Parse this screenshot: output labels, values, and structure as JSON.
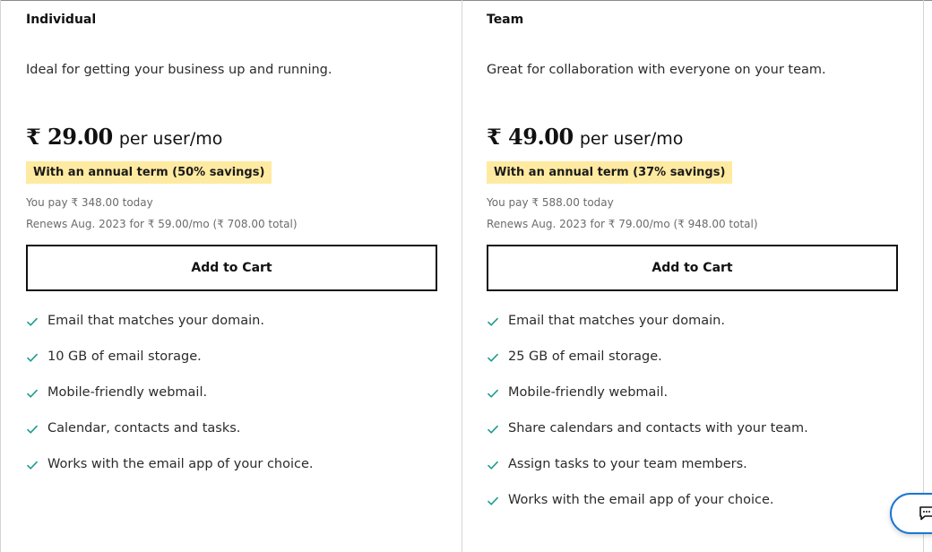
{
  "plans": [
    {
      "title": "Individual",
      "description": "Ideal for getting your business up and running.",
      "price": "₹ 29.00",
      "price_unit": "per user/mo",
      "savings": "With an annual term (50% savings)",
      "you_pay": "You pay ₹ 348.00 today",
      "renews": "Renews Aug. 2023 for ₹ 59.00/mo (₹ 708.00 total)",
      "cta": "Add to Cart",
      "features": [
        "Email that matches your domain.",
        "10 GB of email storage.",
        "Mobile-friendly webmail.",
        "Calendar, contacts and tasks.",
        "Works with the email app of your choice."
      ]
    },
    {
      "title": "Team",
      "description": "Great for collaboration with everyone on your team.",
      "price": "₹ 49.00",
      "price_unit": "per user/mo",
      "savings": "With an annual term (37% savings)",
      "you_pay": "You pay ₹ 588.00 today",
      "renews": "Renews Aug. 2023 for ₹ 79.00/mo (₹ 948.00 total)",
      "cta": "Add to Cart",
      "features": [
        "Email that matches your domain.",
        "25 GB of email storage.",
        "Mobile-friendly webmail.",
        "Share calendars and contacts with your team.",
        "Assign tasks to your team members.",
        "Works with the email app of your choice."
      ]
    }
  ],
  "icons": {
    "feature_check": "check-icon",
    "chat": "chat-icon"
  },
  "colors": {
    "check": "#1a9b8e",
    "savings_bg": "#ffeaa1",
    "chat_border": "#1976d2"
  }
}
